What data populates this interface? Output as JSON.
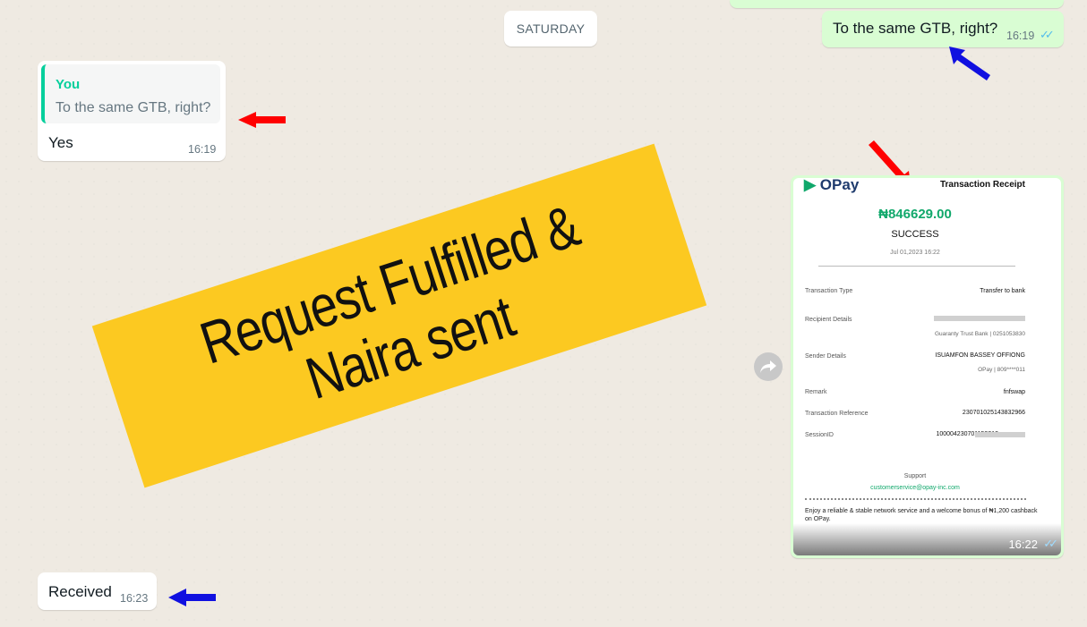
{
  "chat": {
    "date_chip": "SATURDAY",
    "msg1": {
      "text": "To the same GTB, right?",
      "time": "16:19",
      "ticks": "✓✓"
    },
    "msg2": {
      "quote_author": "You",
      "quote_text": "To the same GTB, right?",
      "text": "Yes",
      "time": "16:19"
    },
    "msg3": {
      "time": "16:22",
      "ticks": "✓✓"
    },
    "msg4": {
      "text": "Received",
      "time": "16:23"
    }
  },
  "banner": {
    "line1": "Request Fulfilled &",
    "line2": "Naira sent"
  },
  "receipt": {
    "logo": "OPay",
    "title": "Transaction Receipt",
    "amount": "₦846629.00",
    "status": "SUCCESS",
    "date": "Jul 01,2023 16:22",
    "rows": [
      {
        "label": "Transaction Type",
        "value": "Transfer to bank",
        "sub": ""
      },
      {
        "label": "Recipient Details",
        "value": "",
        "sub": "Guaranty Trust Bank | 0251053830"
      },
      {
        "label": "Sender Details",
        "value": "ISUAMFON BASSEY OFFIONG",
        "sub": "OPay | 809****011"
      },
      {
        "label": "Remark",
        "value": "fnfswap",
        "sub": ""
      },
      {
        "label": "Transaction Reference",
        "value": "230701025143832966",
        "sub": ""
      },
      {
        "label": "SessionID",
        "value": "100004230701152212",
        "sub": ""
      }
    ],
    "support_label": "Support",
    "support_email": "customerservice@opay-inc.com",
    "promo": "Enjoy a reliable & stable network service and a welcome bonus of ₦1,200 cashback on OPay."
  },
  "colors": {
    "outgoing_bubble": "#d9fdd3",
    "incoming_bubble": "#ffffff",
    "chat_background": "#efeae2",
    "quote_accent": "#06cf9c",
    "read_ticks": "#53bdeb",
    "banner": "#fcc921",
    "arrow_red": "#ff0000",
    "arrow_blue": "#1010e0"
  },
  "icons": [
    "double-check-icon",
    "forward-icon",
    "red-arrow-icon",
    "blue-arrow-icon"
  ]
}
